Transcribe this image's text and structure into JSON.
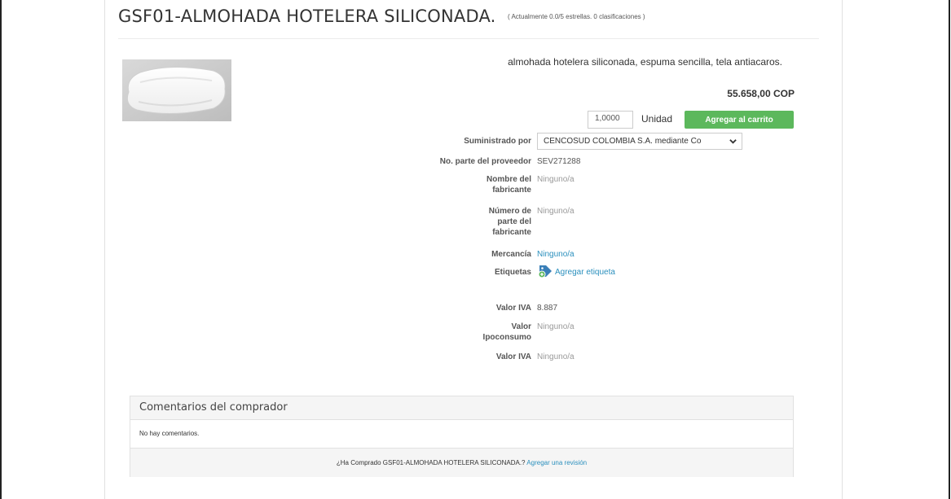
{
  "product": {
    "title": "GSF01-ALMOHADA HOTELERA SILICONADA.",
    "rating_text": "( Actualmente 0.0/5 estrellas. 0 clasificaciones )",
    "description": "almohada hotelera siliconada, espuma sencilla, tela antiacaros.",
    "price": "55.658,00 COP"
  },
  "cart": {
    "quantity": "1,0000",
    "unit": "Unidad",
    "add_button": "Agregar al carrito"
  },
  "details": {
    "supplier_label": "Suministrado por",
    "supplier_value": "CENCOSUD COLOMBIA S.A. mediante Co",
    "supplier_part_label": "No. parte del proveedor",
    "supplier_part_value": "SEV271288",
    "manufacturer_name_label": "Nombre del fabricante",
    "manufacturer_name_value": "Ninguno/a",
    "manufacturer_part_label": "Número de parte del fabricante",
    "manufacturer_part_value": "Ninguno/a",
    "commodity_label": "Mercancía",
    "commodity_value": "Ninguno/a",
    "tags_label": "Etiquetas",
    "tags_link": "Agregar etiqueta",
    "iva_label": "Valor IVA",
    "iva_value": "8.887",
    "ipoconsumo_label": "Valor Ipoconsumo",
    "ipoconsumo_value": "Ninguno/a",
    "iva2_label": "Valor IVA",
    "iva2_value": "Ninguno/a"
  },
  "comments": {
    "heading": "Comentarios del comprador",
    "empty_text": "No hay comentarios.",
    "prompt_text": "¿Ha Comprado GSF01-ALMOHADA HOTELERA SILICONADA.?",
    "review_link": "Agregar una revisión"
  },
  "colors": {
    "accent_green": "#5cb85c",
    "link_blue": "#2a8fbd"
  },
  "icons": [
    "chevron-down-icon",
    "tag-add-icon",
    "pillow-image"
  ]
}
